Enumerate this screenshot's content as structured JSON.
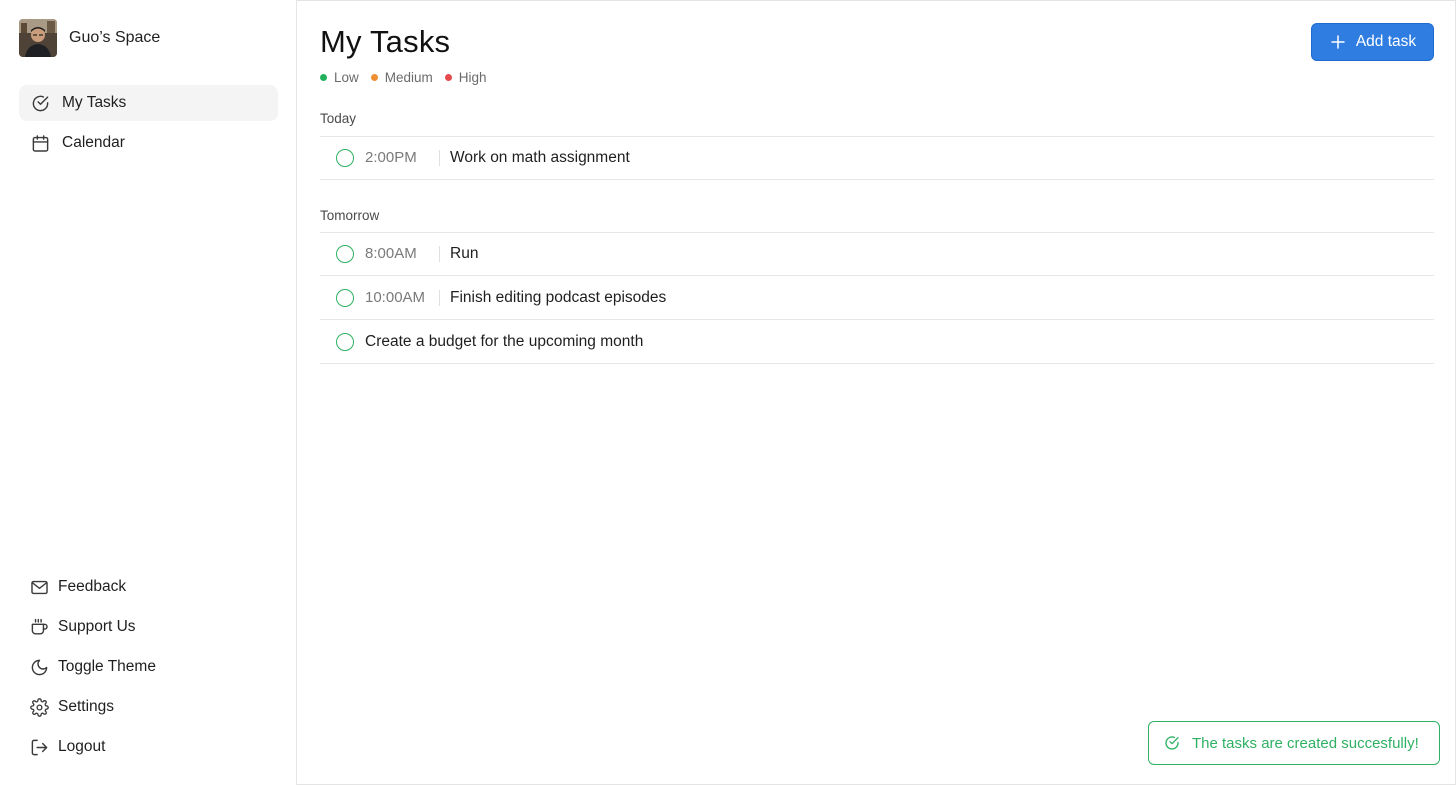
{
  "workspace": {
    "name": "Guo’s Space",
    "avatar_icon": "user-avatar"
  },
  "sidebar": {
    "items": [
      {
        "label": "My Tasks",
        "icon": "check-circle-icon",
        "active": true
      },
      {
        "label": "Calendar",
        "icon": "calendar-icon",
        "active": false
      }
    ],
    "bottom_items": [
      {
        "label": "Feedback",
        "icon": "mail-icon"
      },
      {
        "label": "Support Us",
        "icon": "coffee-cup-icon"
      },
      {
        "label": "Toggle Theme",
        "icon": "moon-icon"
      },
      {
        "label": "Settings",
        "icon": "gear-icon"
      },
      {
        "label": "Logout",
        "icon": "logout-icon"
      }
    ]
  },
  "header": {
    "title": "My Tasks",
    "add_label": "Add task",
    "legend": [
      {
        "label": "Low",
        "color": "#22b05b"
      },
      {
        "label": "Medium",
        "color": "#ef8f33"
      },
      {
        "label": "High",
        "color": "#e5484d"
      }
    ]
  },
  "groups": [
    {
      "label": "Today",
      "tasks": [
        {
          "time": "2:00PM",
          "title": "Work on math assignment"
        }
      ]
    },
    {
      "label": "Tomorrow",
      "tasks": [
        {
          "time": "8:00AM",
          "title": "Run"
        },
        {
          "time": "10:00AM",
          "title": "Finish editing podcast episodes"
        },
        {
          "time": "",
          "title": "Create a budget for the upcoming month"
        }
      ]
    }
  ],
  "toast": {
    "message": "The tasks are created succesfully!",
    "color": "#2fb163"
  },
  "colors": {
    "accent": "#2f7de1",
    "success": "#2fb163"
  }
}
